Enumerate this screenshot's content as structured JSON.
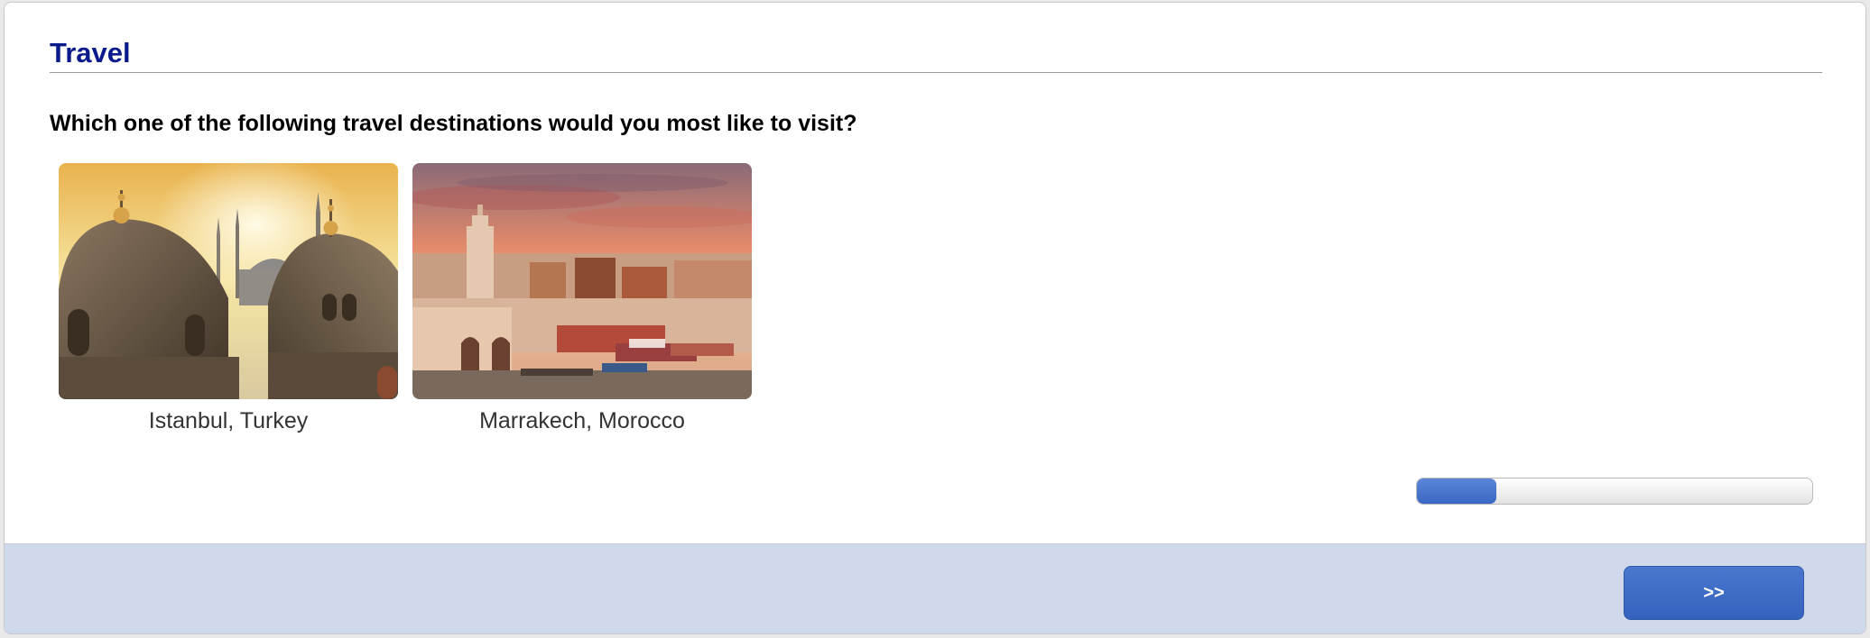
{
  "survey": {
    "title": "Travel",
    "question": "Which one of the following travel destinations would you most like to visit?"
  },
  "choices": [
    {
      "label": "Istanbul, Turkey"
    },
    {
      "label": "Marrakech, Morocco"
    }
  ],
  "progress": {
    "fraction": 0.2
  },
  "navigation": {
    "next_label": ">>"
  },
  "colors": {
    "title": "#0b1b8c",
    "accent": "#3a67c3",
    "footer_background": "#cfd9eb"
  }
}
